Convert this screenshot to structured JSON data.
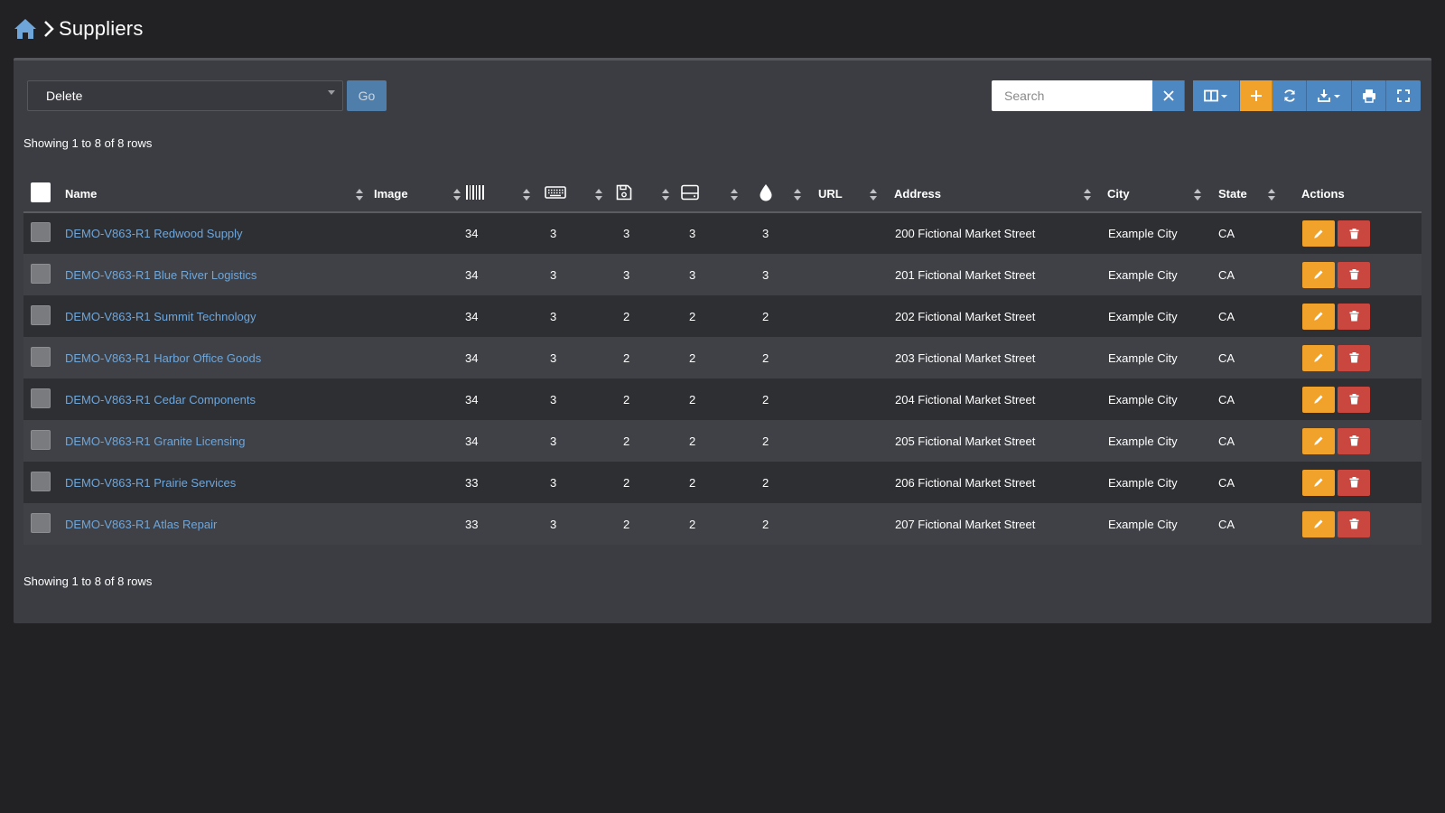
{
  "header": {
    "title": "Suppliers"
  },
  "toolbar": {
    "bulk_action": "Delete",
    "go_label": "Go",
    "search_placeholder": "Search"
  },
  "rows_info": "Showing 1 to 8 of 8 rows",
  "columns": {
    "name": "Name",
    "image": "Image",
    "url": "URL",
    "address": "Address",
    "city": "City",
    "state": "State",
    "actions": "Actions",
    "icon_columns": [
      "barcode-icon",
      "keyboard-icon",
      "floppy-disk-icon",
      "hard-drive-icon",
      "ink-drop-icon"
    ]
  },
  "rows": [
    {
      "name": "DEMO-V863-R1 Redwood Supply",
      "c1": "34",
      "c2": "3",
      "c3": "3",
      "c4": "3",
      "c5": "3",
      "address": "200 Fictional Market Street",
      "city": "Example City",
      "state": "CA"
    },
    {
      "name": "DEMO-V863-R1 Blue River Logistics",
      "c1": "34",
      "c2": "3",
      "c3": "3",
      "c4": "3",
      "c5": "3",
      "address": "201 Fictional Market Street",
      "city": "Example City",
      "state": "CA"
    },
    {
      "name": "DEMO-V863-R1 Summit Technology",
      "c1": "34",
      "c2": "3",
      "c3": "2",
      "c4": "2",
      "c5": "2",
      "address": "202 Fictional Market Street",
      "city": "Example City",
      "state": "CA"
    },
    {
      "name": "DEMO-V863-R1 Harbor Office Goods",
      "c1": "34",
      "c2": "3",
      "c3": "2",
      "c4": "2",
      "c5": "2",
      "address": "203 Fictional Market Street",
      "city": "Example City",
      "state": "CA"
    },
    {
      "name": "DEMO-V863-R1 Cedar Components",
      "c1": "34",
      "c2": "3",
      "c3": "2",
      "c4": "2",
      "c5": "2",
      "address": "204 Fictional Market Street",
      "city": "Example City",
      "state": "CA"
    },
    {
      "name": "DEMO-V863-R1 Granite Licensing",
      "c1": "34",
      "c2": "3",
      "c3": "2",
      "c4": "2",
      "c5": "2",
      "address": "205 Fictional Market Street",
      "city": "Example City",
      "state": "CA"
    },
    {
      "name": "DEMO-V863-R1 Prairie Services",
      "c1": "33",
      "c2": "3",
      "c3": "2",
      "c4": "2",
      "c5": "2",
      "address": "206 Fictional Market Street",
      "city": "Example City",
      "state": "CA"
    },
    {
      "name": "DEMO-V863-R1 Atlas Repair",
      "c1": "33",
      "c2": "3",
      "c3": "2",
      "c4": "2",
      "c5": "2",
      "address": "207 Fictional Market Street",
      "city": "Example City",
      "state": "CA"
    }
  ],
  "colors": {
    "background": "#222224",
    "panel": "#3b3d42",
    "primary": "#4e88c3",
    "warning": "#f0a22a",
    "danger": "#c9473f",
    "link": "#6fa6da"
  }
}
